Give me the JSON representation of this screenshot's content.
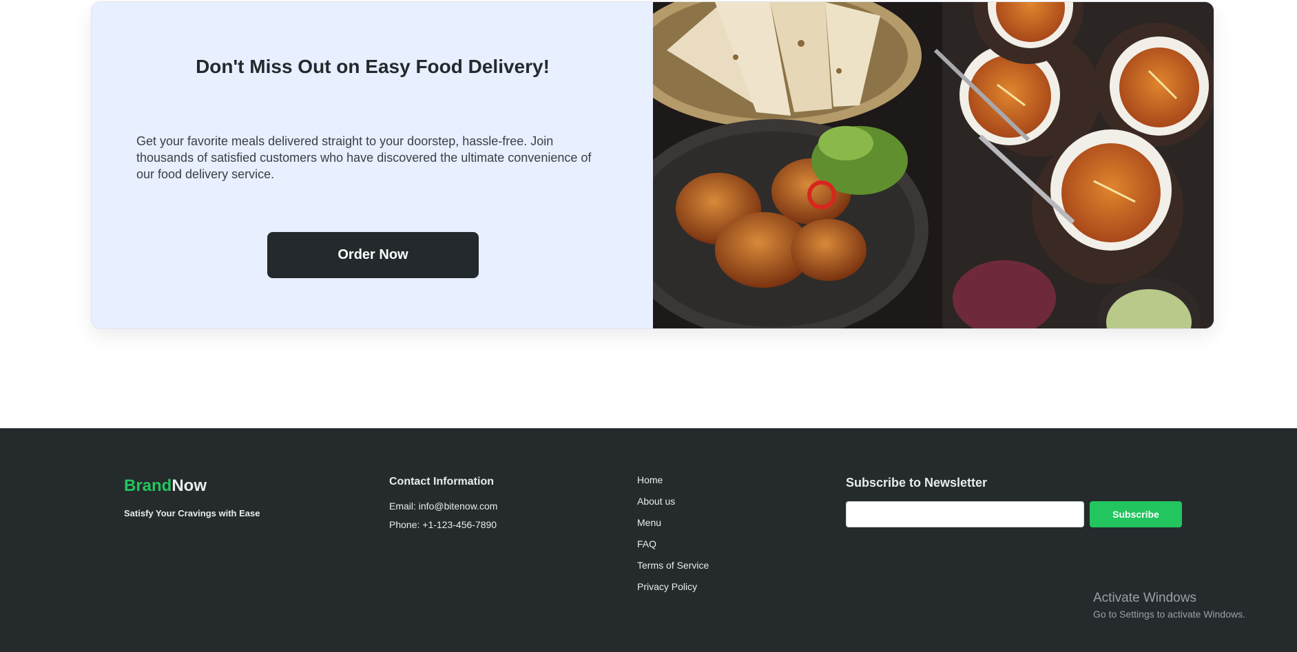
{
  "cta": {
    "title": "Don't Miss Out on Easy Food Delivery!",
    "description": "Get your favorite meals delivered straight to your doorstep, hassle-free. Join thousands of satisfied customers who have discovered the ultimate convenience of our food delivery service.",
    "button_label": "Order Now"
  },
  "footer": {
    "brand": {
      "part1": "Brand",
      "part2": "Now",
      "tagline": "Satisfy Your Cravings with Ease"
    },
    "contact": {
      "title": "Contact Information",
      "email": "Email: info@bitenow.com",
      "phone": "Phone: +1-123-456-7890"
    },
    "links": [
      "Home",
      "About us",
      "Menu",
      "FAQ",
      "Terms of Service",
      "Privacy Policy"
    ],
    "newsletter": {
      "title": "Subscribe to Newsletter",
      "input_value": "",
      "button_label": "Subscribe"
    }
  },
  "os_watermark": {
    "line1": "Activate Windows",
    "line2": "Go to Settings to activate Windows."
  },
  "colors": {
    "dark": "#23292c",
    "accent": "#22c55e",
    "card_bg": "#e8efff",
    "footer_bg": "#252a2c"
  }
}
